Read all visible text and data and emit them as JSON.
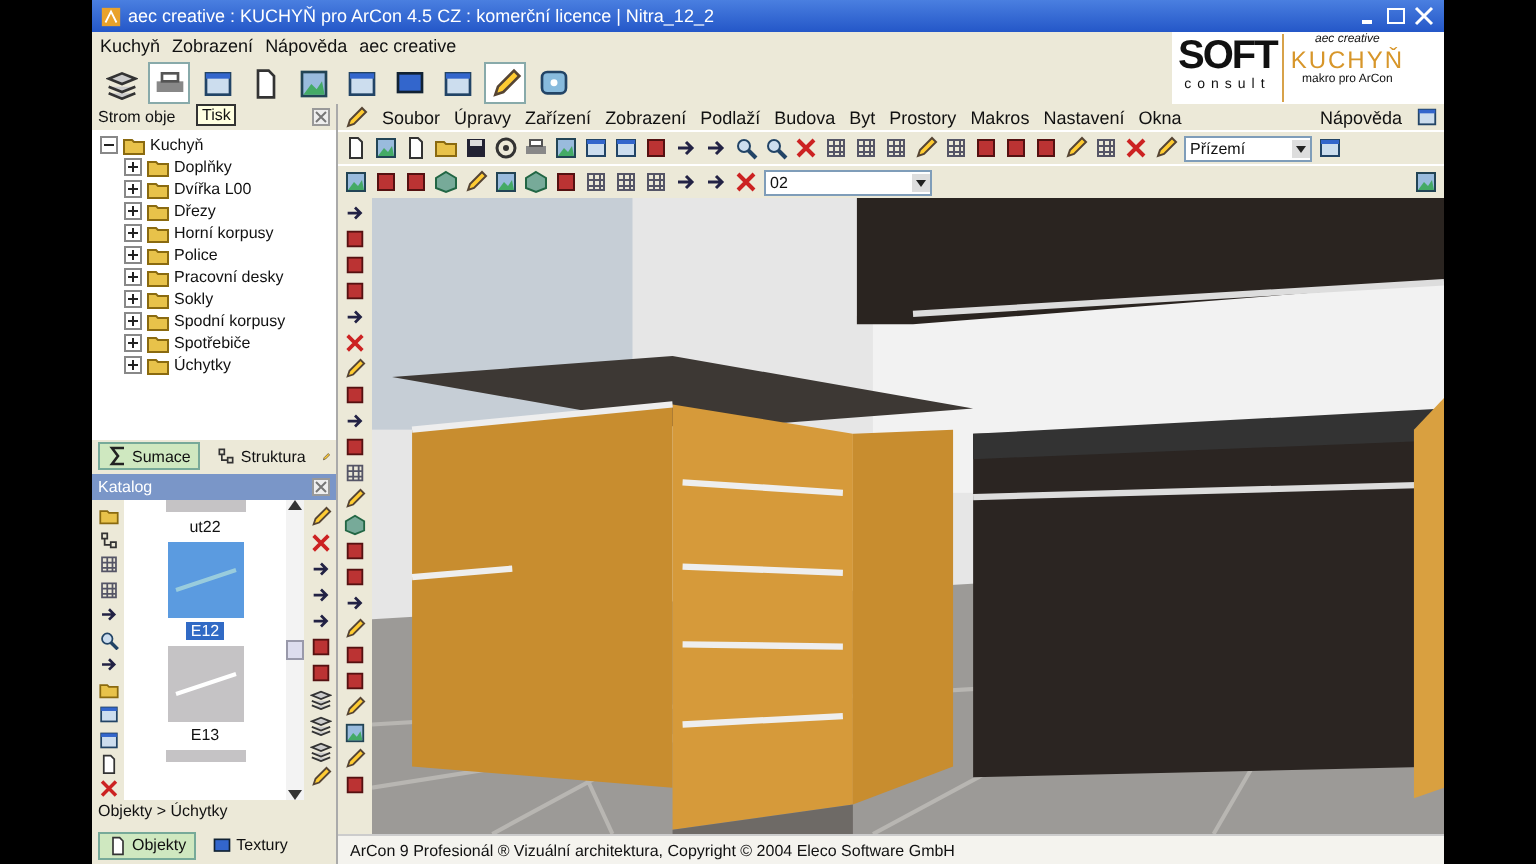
{
  "window": {
    "title": "aec creative : KUCHYŇ pro ArCon 4.5 CZ : komerční licence | Nitra_12_2"
  },
  "menu": [
    "Kuchyň",
    "Zobrazení",
    "Nápověda",
    "aec creative"
  ],
  "toolbar": [
    {
      "pressed": false
    },
    {
      "pressed": true
    },
    {
      "pressed": false
    },
    {
      "pressed": false
    },
    {
      "pressed": false
    },
    {
      "pressed": false
    },
    {
      "pressed": false
    },
    {
      "pressed": false
    },
    {
      "pressed": true
    },
    {
      "pressed": false
    }
  ],
  "tooltip": "Tisk",
  "logo": {
    "brand": "SOFT",
    "sub": "consult",
    "tag": "aec creative",
    "product": "KUCHYŇ",
    "note": "makro pro ArCon"
  },
  "tree_panel": {
    "title": "Strom obje",
    "tree": [
      {
        "label": "Kuchyň",
        "expanded": true,
        "children": [
          {
            "label": "Doplňky",
            "expanded": false
          },
          {
            "label": "Dvířka L00",
            "expanded": false
          },
          {
            "label": "Dřezy",
            "expanded": false
          },
          {
            "label": "Horní korpusy",
            "expanded": false
          },
          {
            "label": "Police",
            "expanded": false
          },
          {
            "label": "Pracovní desky",
            "expanded": false
          },
          {
            "label": "Sokly",
            "expanded": false
          },
          {
            "label": "Spodní korpusy",
            "expanded": false
          },
          {
            "label": "Spotřebiče",
            "expanded": false
          },
          {
            "label": "Úchytky",
            "expanded": false
          }
        ]
      }
    ],
    "tabs": [
      {
        "label": "Sumace",
        "selected": true
      },
      {
        "label": "Struktura",
        "selected": false
      }
    ]
  },
  "catalog": {
    "title": "Katalog",
    "items": [
      {
        "label": "ut22",
        "selected": false
      },
      {
        "label": "E12",
        "selected": true
      },
      {
        "label": "E13",
        "selected": false
      }
    ],
    "breadcrumb": "Objekty > Úchytky",
    "tabs": [
      {
        "label": "Objekty",
        "selected": true
      },
      {
        "label": "Textury",
        "selected": false
      }
    ]
  },
  "arcon": {
    "menu": [
      "Soubor",
      "Úpravy",
      "Zařízení",
      "Zobrazení",
      "Podlaží",
      "Budova",
      "Byt",
      "Prostory",
      "Makros",
      "Nastavení",
      "Okna"
    ],
    "help": "Nápověda",
    "floor": "Přízemí",
    "level": "02"
  },
  "status_bar": "ArCon 9 Profesionál ® Vizuální architektura, Copyright © 2004 Eleco Software GmbH"
}
